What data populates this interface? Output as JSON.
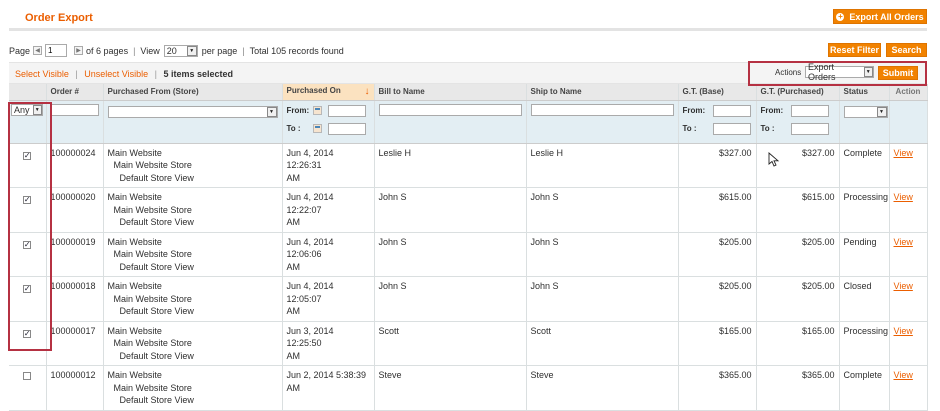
{
  "page": {
    "title": "Order Export",
    "export_all_label": "Export All Orders"
  },
  "pager": {
    "page_label": "Page",
    "page_value": "1",
    "of_pages": "of 6 pages",
    "view_label": "View",
    "per_page_value": "20",
    "per_page_label": "per page",
    "total": "Total 105 records found"
  },
  "filter_buttons": {
    "reset": "Reset Filter",
    "search": "Search"
  },
  "massaction": {
    "select_visible": "Select Visible",
    "unselect_visible": "Unselect Visible",
    "selected_count": "5 items selected",
    "actions_label": "Actions",
    "action_value": "Export Orders",
    "submit": "Submit"
  },
  "columns": {
    "order": "Order #",
    "store": "Purchased From (Store)",
    "purchased_on": "Purchased On",
    "bill_to": "Bill to Name",
    "ship_to": "Ship to Name",
    "gt_base": "G.T. (Base)",
    "gt_purchased": "G.T. (Purchased)",
    "status": "Status",
    "action": "Action"
  },
  "filters": {
    "massaction_any": "Any",
    "from": "From:",
    "to": "To :"
  },
  "rows": [
    {
      "checked": true,
      "order": "100000024",
      "website": "Main Website",
      "store": "Main Website Store",
      "view": "Default Store View",
      "date": "Jun 4, 2014 12:26:31",
      "ampm": "AM",
      "bill": "Leslie H",
      "ship": "Leslie H",
      "gt_base": "$327.00",
      "gt_purchased": "$327.00",
      "status": "Complete",
      "action": "View"
    },
    {
      "checked": true,
      "order": "100000020",
      "website": "Main Website",
      "store": "Main Website Store",
      "view": "Default Store View",
      "date": "Jun 4, 2014 12:22:07",
      "ampm": "AM",
      "bill": "John S",
      "ship": "John S",
      "gt_base": "$615.00",
      "gt_purchased": "$615.00",
      "status": "Processing",
      "action": "View"
    },
    {
      "checked": true,
      "order": "100000019",
      "website": "Main Website",
      "store": "Main Website Store",
      "view": "Default Store View",
      "date": "Jun 4, 2014 12:06:06",
      "ampm": "AM",
      "bill": "John S",
      "ship": "John S",
      "gt_base": "$205.00",
      "gt_purchased": "$205.00",
      "status": "Pending",
      "action": "View"
    },
    {
      "checked": true,
      "order": "100000018",
      "website": "Main Website",
      "store": "Main Website Store",
      "view": "Default Store View",
      "date": "Jun 4, 2014 12:05:07",
      "ampm": "AM",
      "bill": "John S",
      "ship": "John S",
      "gt_base": "$205.00",
      "gt_purchased": "$205.00",
      "status": "Closed",
      "action": "View"
    },
    {
      "checked": true,
      "order": "100000017",
      "website": "Main Website",
      "store": "Main Website Store",
      "view": "Default Store View",
      "date": "Jun 3, 2014 12:25:50",
      "ampm": "AM",
      "bill": "Scott",
      "ship": "Scott",
      "gt_base": "$165.00",
      "gt_purchased": "$165.00",
      "status": "Processing",
      "action": "View"
    },
    {
      "checked": false,
      "order": "100000012",
      "website": "Main Website",
      "store": "Main Website Store",
      "view": "Default Store View",
      "date": "Jun 2, 2014 5:38:39",
      "ampm": "AM",
      "bill": "Steve",
      "ship": "Steve",
      "gt_base": "$365.00",
      "gt_purchased": "$365.00",
      "status": "Complete",
      "action": "View"
    }
  ],
  "colors": {
    "accent": "#eb5e00",
    "button": "#f18200",
    "highlight_box": "#b53142",
    "filter_bg": "#e3eef3",
    "sorted_header": "#fbe2c0"
  },
  "icons": {
    "export": "plus-circle-icon",
    "calendar": "calendar-icon",
    "sort": "sort-down-arrow-icon",
    "checkbox": "checkmark-icon",
    "cursor": "mouse-cursor-icon"
  }
}
